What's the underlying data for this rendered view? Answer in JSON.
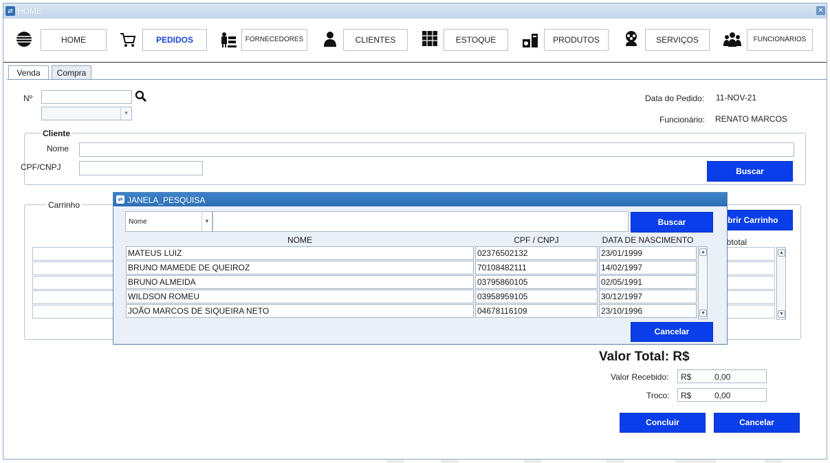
{
  "window": {
    "title": "HOME"
  },
  "nav": [
    {
      "label": "HOME",
      "icon": "globe-icon"
    },
    {
      "label": "PEDIDOS",
      "icon": "cart-icon"
    },
    {
      "label": "FORNECEDORES",
      "icon": "supplier-icon"
    },
    {
      "label": "CLIENTES",
      "icon": "user-icon"
    },
    {
      "label": "ESTOQUE",
      "icon": "warehouse-icon"
    },
    {
      "label": "PRODUTOS",
      "icon": "boxes-icon"
    },
    {
      "label": "SERVIÇOS",
      "icon": "team-gear-icon"
    },
    {
      "label": "FUNCIONÁRIOS",
      "icon": "group-icon"
    }
  ],
  "tabs": [
    "Venda",
    "Compra"
  ],
  "order": {
    "number_label": "Nº",
    "date_label": "Data do Pedido:",
    "date_value": "11-NOV-21",
    "employee_label": "Funcionário:",
    "employee_value": "RENATO MARCOS"
  },
  "client": {
    "title": "Cliente",
    "name_label": "Nome",
    "doc_label": "CPF/CNPJ",
    "search_button": "Buscar"
  },
  "cart": {
    "title": "Carrinho",
    "open_button": "Abrir Carrinho",
    "subtotal_header": "Subtotal"
  },
  "totals": {
    "total_label": "Valor Total: R$",
    "received_label": "Valor Recebido:",
    "received_currency": "R$",
    "received_value": "0,00",
    "change_label": "Troco:",
    "change_currency": "R$",
    "change_value": "0,00",
    "finish_button": "Concluir",
    "cancel_button": "Cancelar"
  },
  "dialog": {
    "title": "JANELA_PESQUISA",
    "filter_value": "Nome",
    "search_button": "Buscar",
    "cancel_button": "Cancelar",
    "columns": [
      "NOME",
      "CPF / CNPJ",
      "DATA DE NASCIMENTO"
    ],
    "rows": [
      [
        "MATEUS LUIZ",
        "02376502132",
        "23/01/1999"
      ],
      [
        "BRUNO MAMEDE DE QUEIROZ",
        "70108482111",
        "14/02/1997"
      ],
      [
        "BRUNO ALMEIDA",
        "03795860105",
        "02/05/1991"
      ],
      [
        "WILDSON ROMEU",
        "03958959105",
        "30/12/1997"
      ],
      [
        "JOÃO MARCOS DE SIQUEIRA NETO",
        "04678116109",
        "23/10/1996"
      ]
    ]
  }
}
